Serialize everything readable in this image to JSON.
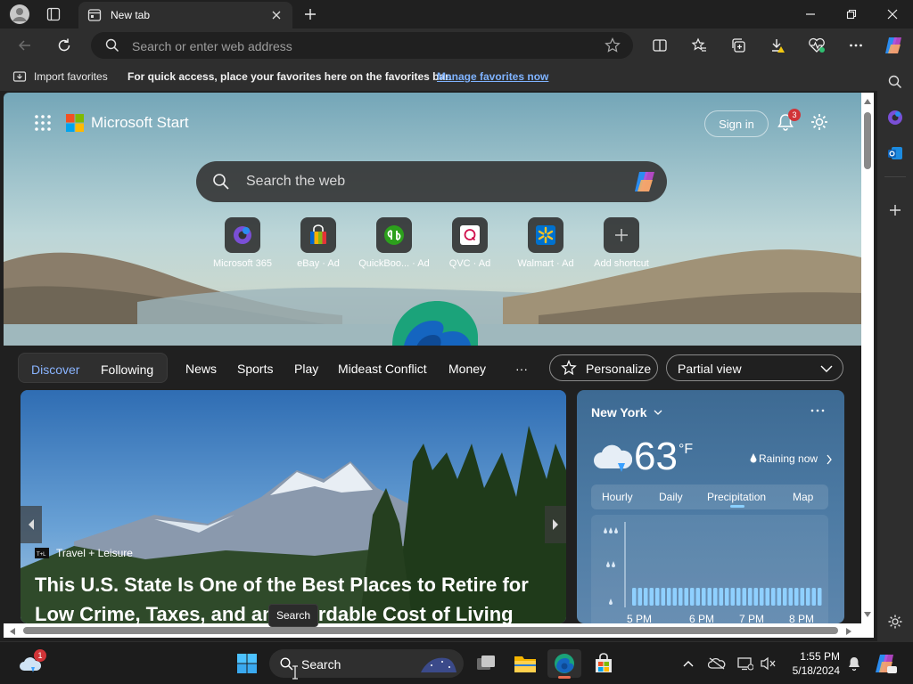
{
  "browser": {
    "tab_title": "New tab",
    "address_placeholder": "Search or enter web address"
  },
  "favorites_bar": {
    "import_label": "Import favorites",
    "hint": "For quick access, place your favorites here on the favorites bar.",
    "manage_link": "Manage favorites now"
  },
  "start_page": {
    "brand": "Microsoft Start",
    "sign_in": "Sign in",
    "notification_count": "3",
    "search_placeholder": "Search the web",
    "shortcuts": [
      {
        "label": "Microsoft 365",
        "icon": "microsoft-365-icon"
      },
      {
        "label": "eBay · Ad",
        "icon": "ebay-icon"
      },
      {
        "label": "QuickBoo... · Ad",
        "icon": "quickbooks-icon"
      },
      {
        "label": "QVC · Ad",
        "icon": "qvc-icon"
      },
      {
        "label": "Walmart · Ad",
        "icon": "walmart-icon"
      },
      {
        "label": "Add shortcut",
        "icon": "plus-icon"
      }
    ]
  },
  "feed_nav": {
    "discover": "Discover",
    "following": "Following",
    "links": [
      "News",
      "Sports",
      "Play",
      "Mideast Conflict",
      "Money"
    ],
    "more": "···",
    "personalize": "Personalize",
    "view_select": "Partial view"
  },
  "news_card": {
    "source": "Travel + Leisure",
    "headline": "This U.S. State Is One of the Best Places to Retire for Low Crime, Taxes, and an Affordable Cost of Living"
  },
  "weather": {
    "city": "New York",
    "temperature": "63",
    "unit": "°F",
    "condition": "Raining now",
    "tabs": [
      "Hourly",
      "Daily",
      "Precipitation",
      "Map"
    ],
    "active_tab": "Precipitation",
    "hours": [
      "5 PM",
      "6 PM",
      "7 PM",
      "8 PM"
    ]
  },
  "taskbar": {
    "search_label": "Search",
    "tooltip": "Search",
    "time": "1:55 PM",
    "date": "5/18/2024",
    "weather_badge": "1"
  },
  "colors": {
    "accent_link": "#7fb3ff",
    "discover_active": "#8ab4ff",
    "notification_badge": "#d13438"
  }
}
